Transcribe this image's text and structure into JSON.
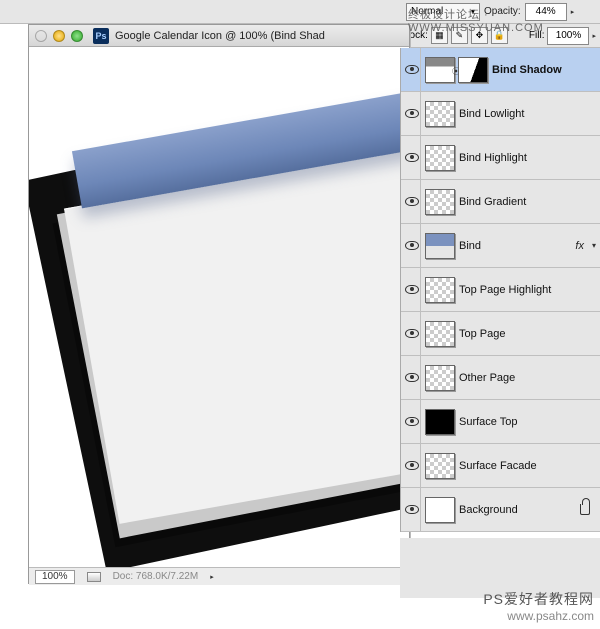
{
  "option_bar": {
    "blend_mode": "Normal",
    "opacity_label": "Opacity:",
    "opacity_value": "44%",
    "lock_label": "Lock:",
    "fill_label": "Fill:",
    "fill_value": "100%"
  },
  "document": {
    "ps_badge": "Ps",
    "title": "Google Calendar Icon @ 100% (Bind Shad",
    "zoom": "100%",
    "status_doc": "Doc: 768.0K/7.22M"
  },
  "layers": [
    {
      "name": "Bind Shadow",
      "active": true,
      "thumb": "graywhite",
      "has_mask": true,
      "mask": "mask-split",
      "fx": false
    },
    {
      "name": "Bind Lowlight",
      "active": false,
      "thumb": "checker",
      "has_mask": false,
      "fx": false
    },
    {
      "name": "Bind Highlight",
      "active": false,
      "thumb": "checker",
      "has_mask": false,
      "fx": false
    },
    {
      "name": "Bind Gradient",
      "active": false,
      "thumb": "checker",
      "has_mask": false,
      "fx": false
    },
    {
      "name": "Bind",
      "active": false,
      "thumb": "bluebar",
      "has_mask": false,
      "fx": true
    },
    {
      "name": "Top Page Highlight",
      "active": false,
      "thumb": "checker",
      "has_mask": false,
      "fx": false
    },
    {
      "name": "Top Page",
      "active": false,
      "thumb": "checker",
      "has_mask": false,
      "fx": false
    },
    {
      "name": "Other Page",
      "active": false,
      "thumb": "checker",
      "has_mask": false,
      "fx": false
    },
    {
      "name": "Surface Top",
      "active": false,
      "thumb": "black",
      "has_mask": false,
      "fx": false
    },
    {
      "name": "Surface Facade",
      "active": false,
      "thumb": "checker",
      "has_mask": false,
      "fx": false
    },
    {
      "name": "Background",
      "active": false,
      "thumb": "maskwhite",
      "has_mask": false,
      "fx": false,
      "locked": true
    }
  ],
  "fx_text": "fx",
  "watermark": {
    "top": "终极设计论坛 · WWW.MISSYUAN.COM",
    "line1": "PS爱好者教程网",
    "line2": "www.psahz.com"
  }
}
